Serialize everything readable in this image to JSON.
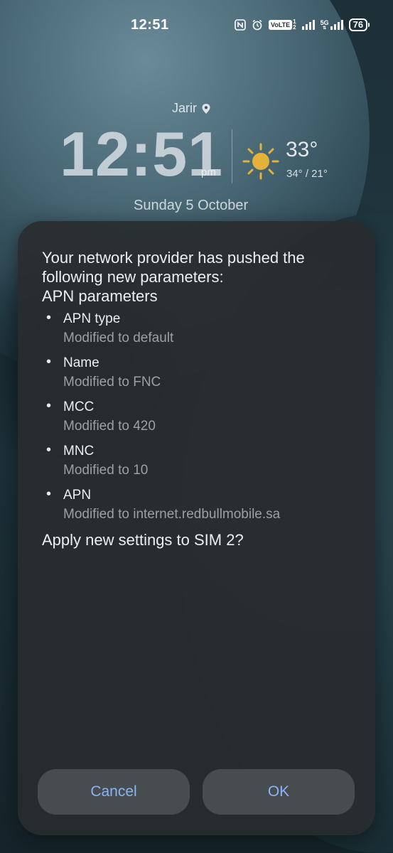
{
  "status_bar": {
    "time": "12:51",
    "volte_label": "VoLTE",
    "sim_index": "1",
    "sim_index2": "2",
    "network": "5G",
    "battery": "76",
    "icons": [
      "nfc-icon",
      "alarm-icon",
      "volte-icon",
      "signal-bars-icon",
      "5g-signal-icon",
      "battery-icon"
    ]
  },
  "lockscreen": {
    "location": "Jarir",
    "time": "12:51",
    "ampm": "pm",
    "temperature": "33°",
    "temp_range": "34° / 21°",
    "date": "Sunday 5 October",
    "weather_icon": "sun-icon",
    "location_icon": "location-pin-icon"
  },
  "dialog": {
    "message": "Your network provider has pushed the following new parameters:",
    "section_title": "APN parameters",
    "parameters": [
      {
        "name": "APN type",
        "value": "Modified to default"
      },
      {
        "name": "Name",
        "value": "Modified to FNC"
      },
      {
        "name": "MCC",
        "value": "Modified to 420"
      },
      {
        "name": "MNC",
        "value": "Modified to 10"
      },
      {
        "name": "APN",
        "value": "Modified to internet.redbullmobile.sa"
      }
    ],
    "question": "Apply new settings to SIM 2?",
    "cancel_label": "Cancel",
    "ok_label": "OK",
    "button_text_color": "#8ab4f8"
  }
}
